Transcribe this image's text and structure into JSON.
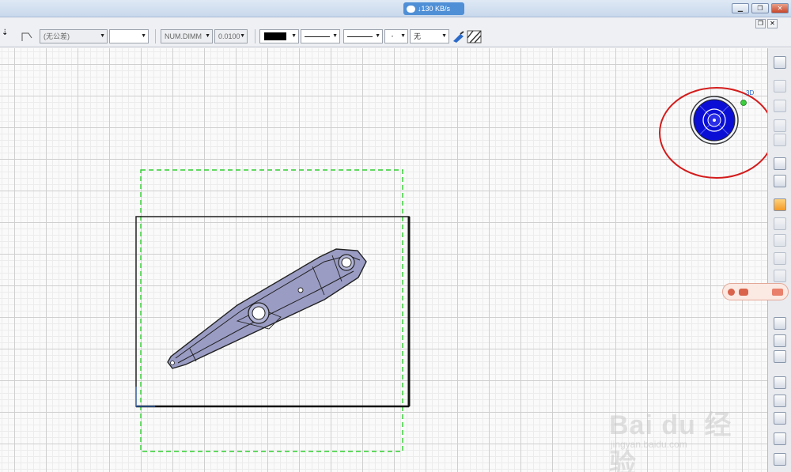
{
  "titlebar": {
    "net_speed": "↓130 KB/s"
  },
  "toolbar": {
    "tolerance_combo": "(无公差)",
    "combo_empty": "",
    "num_format_combo": "NUM.DIMM",
    "precision_combo": "0.0100",
    "color_value": "#000000",
    "pattern_combo": "无"
  },
  "compass": {
    "mode_label": "3D"
  },
  "watermark": {
    "brand": "Bai du 经验",
    "url": "jingyan.baidu.com"
  },
  "colors": {
    "frame_green": "#2fce2f",
    "compass_blue": "#0b0fd6",
    "highlight_red": "#d41c1c",
    "part_fill": "#9a9cc4"
  }
}
